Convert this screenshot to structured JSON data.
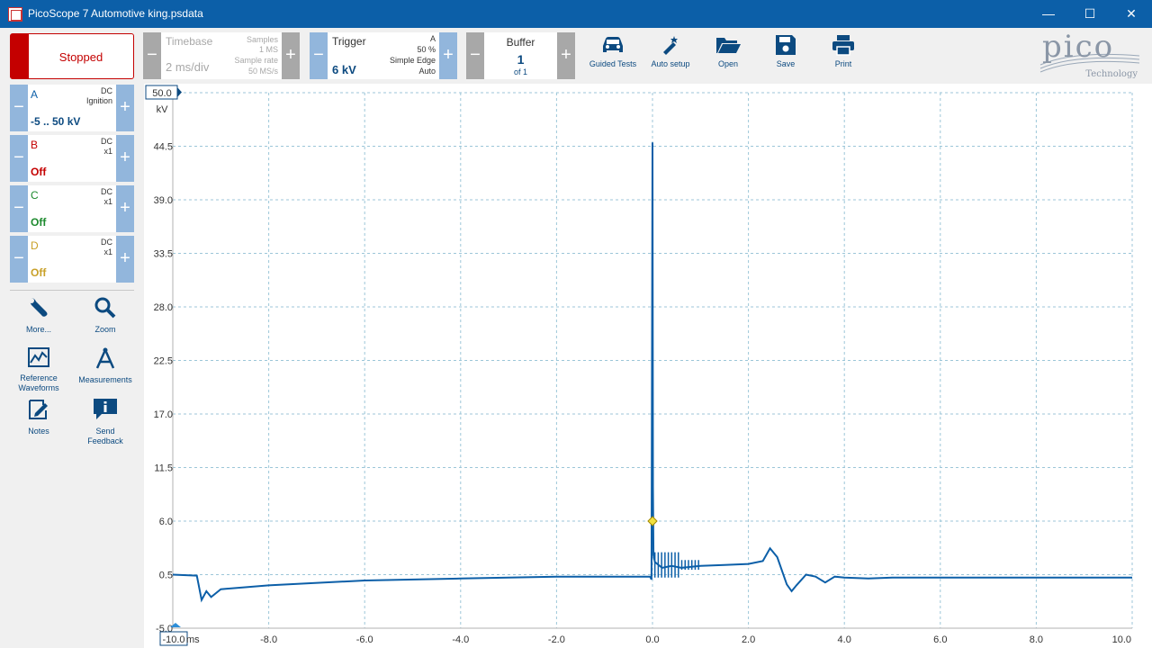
{
  "window": {
    "title": "PicoScope 7 Automotive king.psdata",
    "minimize": "—",
    "maximize": "☐",
    "close": "✕"
  },
  "toolbar": {
    "run_state": "Stopped",
    "timebase": {
      "label": "Timebase",
      "value": "2 ms/div",
      "samples_label": "Samples",
      "samples": "1 MS",
      "rate_label": "Sample rate",
      "rate": "50 MS/s"
    },
    "trigger": {
      "label": "Trigger",
      "value": "6 kV",
      "channel": "A",
      "percent": "50 %",
      "type": "Simple Edge",
      "mode": "Auto"
    },
    "buffer": {
      "label": "Buffer",
      "value": "1",
      "of": "of 1"
    },
    "tools": [
      {
        "label": "Guided Tests",
        "icon": "car-icon"
      },
      {
        "label": "Auto setup",
        "icon": "magic-wand-icon"
      },
      {
        "label": "Open",
        "icon": "folder-open-icon"
      },
      {
        "label": "Save",
        "icon": "save-icon"
      },
      {
        "label": "Print",
        "icon": "printer-icon"
      }
    ],
    "logo_text": "pico",
    "logo_sub": "Technology"
  },
  "channels": [
    {
      "name": "A",
      "coupling": "DC",
      "probe": "Ignition",
      "value": "-5 .. 50 kV",
      "color": "#0c5fa8",
      "value_color": "#0c4a80"
    },
    {
      "name": "B",
      "coupling": "DC",
      "probe": "x1",
      "value": "Off",
      "color": "#c40000",
      "value_color": "#c40000"
    },
    {
      "name": "C",
      "coupling": "DC",
      "probe": "x1",
      "value": "Off",
      "color": "#1d8a2e",
      "value_color": "#1d8a2e"
    },
    {
      "name": "D",
      "coupling": "DC",
      "probe": "x1",
      "value": "Off",
      "color": "#c8a028",
      "value_color": "#c8a028"
    }
  ],
  "side_tools": [
    {
      "label": "More...",
      "icon": "wrench-icon"
    },
    {
      "label": "Zoom",
      "icon": "magnifier-icon"
    },
    {
      "label": "Reference Waveforms",
      "icon": "reference-waveform-icon"
    },
    {
      "label": "Measurements",
      "icon": "measurement-icon"
    },
    {
      "label": "Notes",
      "icon": "notes-icon"
    },
    {
      "label": "Send Feedback",
      "icon": "feedback-icon"
    }
  ],
  "plot": {
    "y_unit": "kV",
    "y_top_label": "50.0",
    "y_ticks": [
      "44.5",
      "39.0",
      "33.5",
      "28.0",
      "22.5",
      "17.0",
      "11.5",
      "6.0",
      "0.5",
      "-5.0"
    ],
    "x_left_label": "-10.0",
    "x_unit": "ms",
    "x_ticks": [
      "-8.0",
      "-6.0",
      "-4.0",
      "-2.0",
      "0.0",
      "2.0",
      "4.0",
      "6.0",
      "8.0",
      "10.0"
    ],
    "trace_color": "#0c5fa8",
    "trigger_marker_color": "#f0e040"
  },
  "chart_data": {
    "type": "line",
    "xlabel": "ms",
    "ylabel": "kV",
    "xlim": [
      -10,
      10
    ],
    "ylim": [
      -5,
      50
    ],
    "grid": true,
    "series": [
      {
        "x": [
          -10,
          -9.5,
          -9.4,
          -9.3,
          -9.2,
          -9.0,
          -8.0,
          -6.0,
          -4.0,
          -2.0,
          -0.05,
          -0.02,
          0.0,
          0.01,
          0.02,
          0.05,
          0.1,
          0.2,
          0.4,
          0.6,
          1.0,
          1.5,
          2.0,
          2.3,
          2.45,
          2.6,
          2.8,
          2.9,
          3.0,
          3.2,
          3.4,
          3.6,
          3.8,
          4.0,
          4.5,
          5.0,
          6.0,
          8.0,
          10.0
        ],
        "y": [
          0.5,
          0.4,
          -2.1,
          -1.2,
          -1.8,
          -1.0,
          -0.6,
          -0.1,
          0.1,
          0.3,
          0.3,
          0.0,
          44.9,
          9.5,
          2.5,
          1.8,
          1.6,
          1.2,
          1.4,
          1.2,
          1.4,
          1.5,
          1.6,
          1.9,
          3.2,
          2.3,
          -0.5,
          -1.2,
          -0.6,
          0.5,
          0.3,
          -0.3,
          0.3,
          0.2,
          0.1,
          0.2,
          0.2,
          0.2,
          0.2
        ]
      }
    ],
    "trigger": {
      "x": 0.0,
      "y": 6.0
    }
  }
}
